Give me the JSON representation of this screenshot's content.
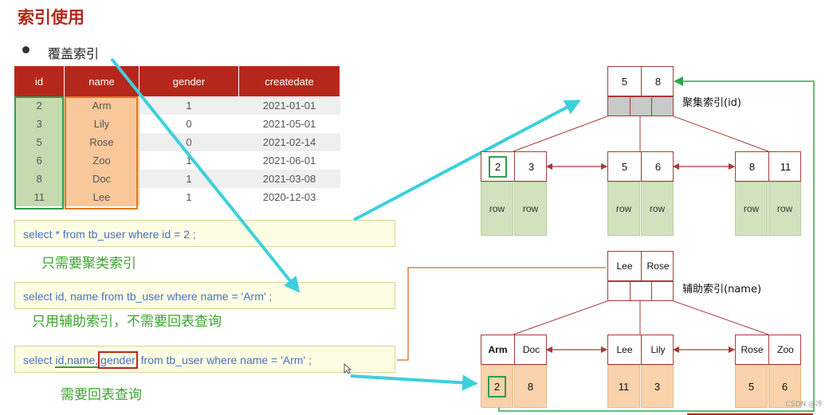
{
  "title": "索引使用",
  "bullet": "覆盖索引",
  "table": {
    "headers": [
      "id",
      "name",
      "gender",
      "createdate"
    ],
    "rows": [
      [
        "2",
        "Arm",
        "1",
        "2021-01-01"
      ],
      [
        "3",
        "Lily",
        "0",
        "2021-05-01"
      ],
      [
        "5",
        "Rose",
        "0",
        "2021-02-14"
      ],
      [
        "6",
        "Zoo",
        "1",
        "2021-06-01"
      ],
      [
        "8",
        "Doc",
        "1",
        "2021-03-08"
      ],
      [
        "11",
        "Lee",
        "1",
        "2020-12-03"
      ]
    ]
  },
  "queries": [
    {
      "sql": "select * from tb_user where id = 2 ;",
      "note": "只需要聚类索引"
    },
    {
      "sql": "select id, name from tb_user where name = 'Arm' ;",
      "note": "只用辅助索引，不需要回表查询"
    },
    {
      "sql_prefix": "select ",
      "sql_id_name": "id,name,",
      "sql_gender": "gender",
      "sql_rest": " from tb_user where name = 'Arm' ;",
      "note": "需要回表查询"
    }
  ],
  "clustered_index": {
    "label": "聚集索引(id)",
    "root": [
      "5",
      "8"
    ],
    "leaves": [
      [
        "2",
        "3"
      ],
      [
        "5",
        "6"
      ],
      [
        "8",
        "11"
      ]
    ],
    "row_label": "row"
  },
  "secondary_index": {
    "label": "辅助索引(name)",
    "root": [
      "Lee",
      "Rose"
    ],
    "leaves": [
      {
        "keys": [
          "Arm",
          "Doc"
        ],
        "ids": [
          "2",
          "8"
        ]
      },
      {
        "keys": [
          "Lee",
          "Lily"
        ],
        "ids": [
          "11",
          "3"
        ]
      },
      {
        "keys": [
          "Rose",
          "Zoo"
        ],
        "ids": [
          "5",
          "6"
        ]
      }
    ]
  },
  "watermark": "CSDN @冷",
  "colors": {
    "header_red": "#b5271b",
    "node_border": "#a83a3a",
    "leaf_green": "#d3e2be",
    "leaf_orange": "#fad2ab",
    "arrow_cyan": "#3dd0dc",
    "connector_green": "#2ba84a",
    "connector_orange": "#d46a1a"
  }
}
